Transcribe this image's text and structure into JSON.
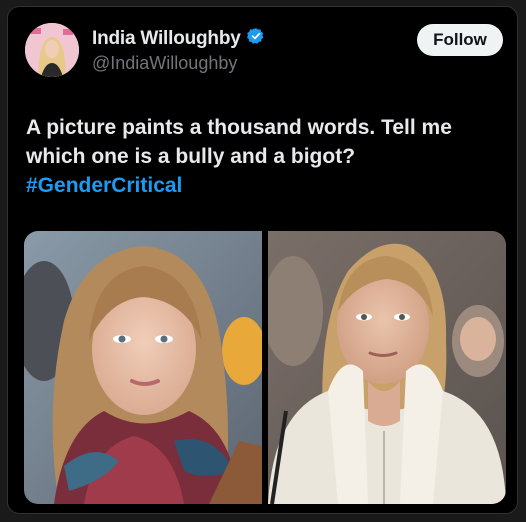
{
  "author": {
    "display_name": "India Willoughby",
    "handle": "@IndiaWilloughby",
    "verified": true,
    "avatar": "avatar-photo"
  },
  "follow_button": {
    "label": "Follow"
  },
  "tweet": {
    "text": "A picture paints a thousand words. Tell me which one is a bully and a bigot?",
    "hashtag": "#GenderCritical"
  },
  "media": {
    "photos": [
      {
        "name": "left-photo",
        "subject": "woman-with-scarf"
      },
      {
        "name": "right-photo",
        "subject": "woman-in-white-jacket"
      }
    ]
  },
  "colors": {
    "background": "#000000",
    "text": "#e7e9ea",
    "secondary_text": "#71767b",
    "link": "#1d9bf0",
    "verified_badge": "#1d9bf0"
  }
}
